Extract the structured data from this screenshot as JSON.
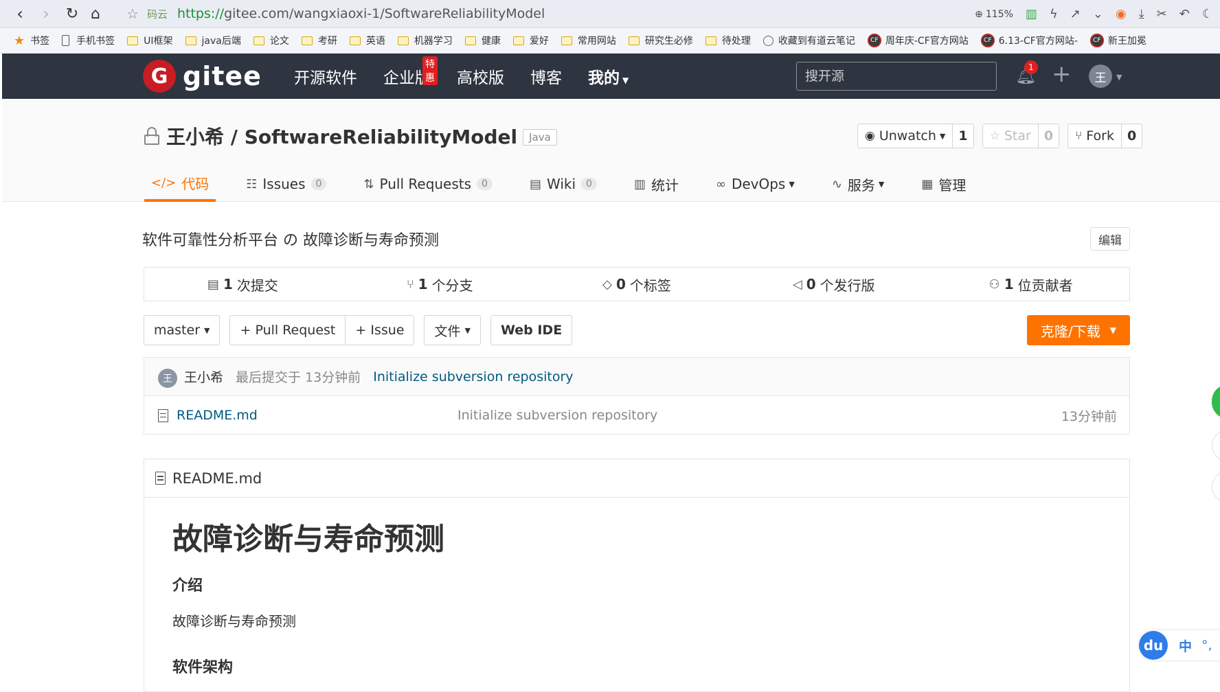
{
  "browser": {
    "site_label": "码云",
    "url_proto": "https://",
    "url_rest": "gitee.com/wangxiaoxi-1/SoftwareReliabilityModel",
    "zoom": "115%"
  },
  "bookmarks": [
    {
      "icon": "star-icon",
      "label": "书签"
    },
    {
      "icon": "phone-icon",
      "label": "手机书签"
    },
    {
      "icon": "folder-icon",
      "label": "UI框架"
    },
    {
      "icon": "folder-icon",
      "label": "java后端"
    },
    {
      "icon": "folder-icon",
      "label": "论文"
    },
    {
      "icon": "folder-icon",
      "label": "考研"
    },
    {
      "icon": "folder-icon",
      "label": "英语"
    },
    {
      "icon": "folder-icon",
      "label": "机器学习"
    },
    {
      "icon": "folder-icon",
      "label": "健康"
    },
    {
      "icon": "folder-icon",
      "label": "爱好"
    },
    {
      "icon": "folder-icon",
      "label": "常用网站"
    },
    {
      "icon": "folder-icon",
      "label": "研究生必修"
    },
    {
      "icon": "folder-icon",
      "label": "待处理"
    },
    {
      "icon": "globe-icon",
      "label": "收藏到有道云笔记"
    },
    {
      "icon": "cf-icon",
      "label": "周年庆-CF官方网站"
    },
    {
      "icon": "cf-icon",
      "label": "6.13-CF官方网站-"
    },
    {
      "icon": "cf-icon",
      "label": "新王加冕"
    }
  ],
  "header": {
    "logo_letter": "G",
    "logo_text": "gitee",
    "nav": [
      "开源软件",
      "企业版",
      "高校版",
      "博客",
      "我的"
    ],
    "hot_badge": "特惠",
    "search_placeholder": "搜开源",
    "notification_count": "1",
    "avatar_letter": "王"
  },
  "repo": {
    "title": "王小希 / SoftwareReliabilityModel",
    "language": "Java",
    "watch": {
      "label": "Unwatch",
      "count": "1"
    },
    "star": {
      "label": "Star",
      "count": "0"
    },
    "fork": {
      "label": "Fork",
      "count": "0"
    },
    "tabs": [
      {
        "label": "代码",
        "count": null
      },
      {
        "label": "Issues",
        "count": "0"
      },
      {
        "label": "Pull Requests",
        "count": "0"
      },
      {
        "label": "Wiki",
        "count": "0"
      },
      {
        "label": "统计",
        "count": null
      },
      {
        "label": "DevOps",
        "count": null
      },
      {
        "label": "服务",
        "count": null
      },
      {
        "label": "管理",
        "count": null
      }
    ],
    "description": "软件可靠性分析平台 の 故障诊断与寿命预测",
    "edit_label": "编辑"
  },
  "stats": [
    {
      "num": "1",
      "label": "次提交"
    },
    {
      "num": "1",
      "label": "个分支"
    },
    {
      "num": "0",
      "label": "个标签"
    },
    {
      "num": "0",
      "label": "个发行版"
    },
    {
      "num": "1",
      "label": "位贡献者"
    }
  ],
  "toolbar": {
    "branch": "master",
    "pull_request": "+ Pull Request",
    "issue": "+ Issue",
    "file": "文件",
    "web_ide": "Web IDE",
    "clone": "克隆/下载"
  },
  "commit": {
    "avatar_letter": "王",
    "author": "王小希",
    "time": "最后提交于 13分钟前",
    "message": "Initialize subversion repository"
  },
  "files": [
    {
      "name": "README.md",
      "message": "Initialize subversion repository",
      "time": "13分钟前"
    }
  ],
  "readme": {
    "filename": "README.md",
    "h1": "故障诊断与寿命预测",
    "intro_heading": "介绍",
    "intro_text": "故障诊断与寿命预测",
    "arch_heading": "软件架构"
  },
  "ime": {
    "logo": "du",
    "mode": "中",
    "punc": "°,"
  },
  "colors": {
    "accent": "#fe7300",
    "header_bg": "#2e3440",
    "brand_red": "#c71d23",
    "link": "#005980"
  }
}
